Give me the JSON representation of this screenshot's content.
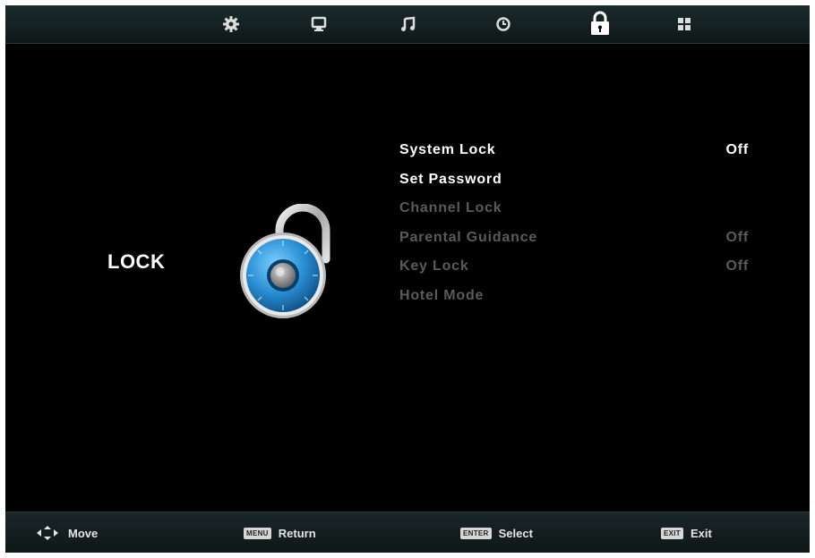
{
  "top_tabs": [
    {
      "icon": "gear-icon",
      "active": false
    },
    {
      "icon": "monitor-icon",
      "active": false
    },
    {
      "icon": "music-note-icon",
      "active": false
    },
    {
      "icon": "clock-icon",
      "active": false
    },
    {
      "icon": "padlock-icon",
      "active": true
    },
    {
      "icon": "grid-icon",
      "active": false
    }
  ],
  "section_title": "LOCK",
  "menu": [
    {
      "label": "System Lock",
      "value": "Off",
      "enabled": true
    },
    {
      "label": "Set Password",
      "value": "",
      "enabled": true
    },
    {
      "label": "Channel Lock",
      "value": "",
      "enabled": false
    },
    {
      "label": "Parental Guidance",
      "value": "Off",
      "enabled": false
    },
    {
      "label": "Key Lock",
      "value": "Off",
      "enabled": false
    },
    {
      "label": "Hotel Mode",
      "value": "",
      "enabled": false
    }
  ],
  "footer": {
    "move_label": "Move",
    "return_key": "MENU",
    "return_label": "Return",
    "select_key": "ENTER",
    "select_label": "Select",
    "exit_key": "EXIT",
    "exit_label": "Exit"
  },
  "colors": {
    "background": "#000000",
    "bar": "#152224",
    "text_enabled": "#ffffff",
    "text_disabled": "#5a5a5a",
    "lock_blue": "#2f8fd0"
  }
}
